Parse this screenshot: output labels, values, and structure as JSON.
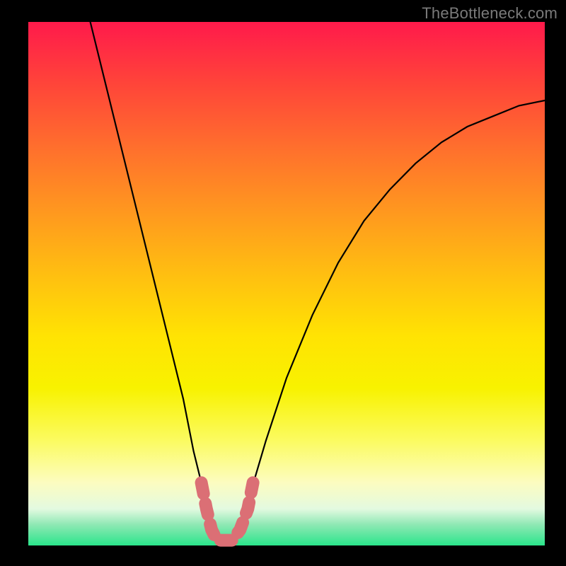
{
  "watermark": "TheBottleneck.com",
  "chart_data": {
    "type": "line",
    "title": "",
    "xlabel": "",
    "ylabel": "",
    "xlim": [
      0,
      100
    ],
    "ylim": [
      0,
      100
    ],
    "series": [
      {
        "name": "bottleneck-curve",
        "x": [
          12,
          15,
          18,
          21,
          24,
          27,
          30,
          32,
          34,
          35.5,
          37,
          39,
          41,
          43,
          46,
          50,
          55,
          60,
          65,
          70,
          75,
          80,
          85,
          90,
          95,
          100
        ],
        "y": [
          100,
          88,
          76,
          64,
          52,
          40,
          28,
          18,
          10,
          4,
          1,
          1,
          4,
          10,
          20,
          32,
          44,
          54,
          62,
          68,
          73,
          77,
          80,
          82,
          84,
          85
        ]
      }
    ],
    "highlight": {
      "name": "bottom-segment",
      "color": "#db6f75",
      "x": [
        33.5,
        34.5,
        35.5,
        36.5,
        38,
        39.5,
        41,
        42.5,
        43.5
      ],
      "y": [
        12,
        7,
        3,
        1,
        1,
        1,
        3,
        7,
        12
      ]
    },
    "background_gradient": [
      "#ff1a4b",
      "#ffbe11",
      "#fbfb61",
      "#2ae58b"
    ]
  }
}
